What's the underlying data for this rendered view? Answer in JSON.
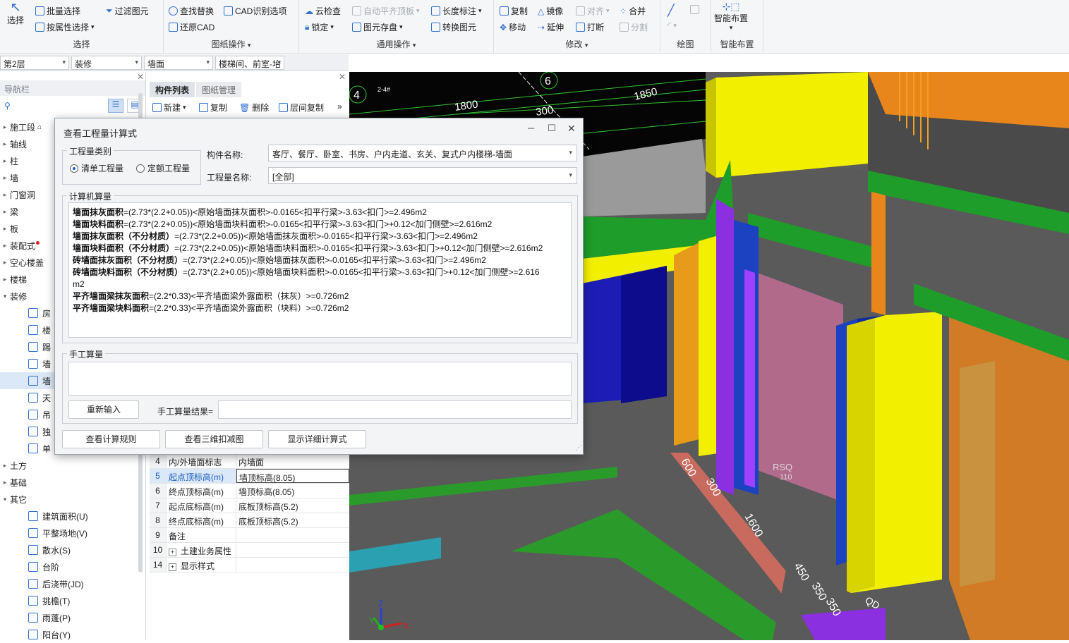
{
  "ribbon": {
    "groups": [
      {
        "title": "选择",
        "items": [
          "选择",
          "批量选择",
          "按属性选择",
          "过滤图元"
        ]
      },
      {
        "title": "图纸操作",
        "items": [
          "查找替换",
          "CAD识别选项",
          "还原CAD"
        ]
      },
      {
        "title": "通用操作",
        "items": [
          "云检查",
          "自动平齐顶板",
          "长度标注",
          "锁定",
          "图元存盘",
          "转换图元"
        ]
      },
      {
        "title": "修改",
        "items": [
          "复制",
          "镜像",
          "对齐",
          "合并",
          "移动",
          "延伸",
          "打断",
          "分割"
        ]
      },
      {
        "title": "绘图",
        "items": []
      },
      {
        "title": "智能布置",
        "items": [
          "智能布置"
        ]
      }
    ]
  },
  "selectors": [
    "第2层",
    "装修",
    "墙面",
    "楼梯间、前室-坮"
  ],
  "nav": {
    "title": "导航栏",
    "items": [
      "施工段",
      "轴线",
      "柱",
      "墙",
      "门窗洞",
      "梁",
      "板",
      "装配式",
      "空心楼盖",
      "楼梯",
      "装修",
      "房",
      "楼",
      "踢",
      "墙",
      "墙",
      "天",
      "吊",
      "独",
      "单",
      "土方",
      "基础",
      "其它",
      "建筑面积(U)",
      "平整场地(V)",
      "散水(S)",
      "台阶",
      "后浇带(JD)",
      "挑檐(T)",
      "雨蓬(P)",
      "阳台(Y)"
    ]
  },
  "comp": {
    "tabs": [
      "构件列表",
      "图纸管理"
    ],
    "toolbar": [
      "新建",
      "复制",
      "删除",
      "层间复制"
    ],
    "props": [
      {
        "n": "4",
        "k": "内/外墙面标志",
        "v": "内墙面"
      },
      {
        "n": "5",
        "k": "起点顶标高(m)",
        "v": "墙顶标高(8.05)"
      },
      {
        "n": "6",
        "k": "终点顶标高(m)",
        "v": "墙顶标高(8.05)"
      },
      {
        "n": "7",
        "k": "起点底标高(m)",
        "v": "底板顶标高(5.2)"
      },
      {
        "n": "8",
        "k": "终点底标高(m)",
        "v": "底板顶标高(5.2)"
      },
      {
        "n": "9",
        "k": "备注",
        "v": ""
      },
      {
        "n": "10",
        "k": "土建业务属性",
        "v": ""
      },
      {
        "n": "14",
        "k": "显示样式",
        "v": ""
      }
    ]
  },
  "view": {
    "labels": [
      "4",
      "6",
      "2-4#",
      "1800",
      "300",
      "1850",
      "600",
      "300",
      "1600",
      "450",
      "350",
      "350",
      "RSQ",
      "110",
      "QD",
      "X",
      "Y",
      "Z"
    ]
  },
  "dialog": {
    "title": "查看工程量计算式",
    "category_legend": "工程量类别",
    "radio1": "清单工程量",
    "radio2": "定额工程量",
    "comp_name_label": "构件名称:",
    "comp_name_value": "客厅、餐厅、卧室、书房、户内走道、玄关、复式户内楼梯-墙面",
    "qty_name_label": "工程量名称:",
    "qty_name_value": "[全部]",
    "computer_legend": "计算机算量",
    "formulas": [
      {
        "b": "墙面抹灰面积",
        "t": "=(2.73*(2.2+0.05))<原始墙面抹灰面积>-0.0165<扣平行梁>-3.63<扣门>=2.496m2"
      },
      {
        "b": "墙面块料面积",
        "t": "=(2.73*(2.2+0.05))<原始墙面块料面积>-0.0165<扣平行梁>-3.63<扣门>+0.12<加门侧壁>=2.616m2"
      },
      {
        "b": "墙面抹灰面积（不分材质）",
        "t": "=(2.73*(2.2+0.05))<原始墙面抹灰面积>-0.0165<扣平行梁>-3.63<扣门>=2.496m2"
      },
      {
        "b": "墙面块料面积（不分材质）",
        "t": "=(2.73*(2.2+0.05))<原始墙面块料面积>-0.0165<扣平行梁>-3.63<扣门>+0.12<加门侧壁>=2.616m2"
      },
      {
        "b": "砖墙面抹灰面积（不分材质）",
        "t": "=(2.73*(2.2+0.05))<原始墙面抹灰面积>-0.0165<扣平行梁>-3.63<扣门>=2.496m2"
      },
      {
        "b": "砖墙面块料面积（不分材质）",
        "t": "=(2.73*(2.2+0.05))<原始墙面块料面积>-0.0165<扣平行梁>-3.63<扣门>+0.12<加门侧壁>=2.616"
      },
      {
        "b": "",
        "t": "m2"
      },
      {
        "b": "平齐墙面梁抹灰面积",
        "t": "=(2.2*0.33)<平齐墙面梁外露面积（抹灰）>=0.726m2"
      },
      {
        "b": "平齐墙面梁块料面积",
        "t": "=(2.2*0.33)<平齐墙面梁外露面积（块料）>=0.726m2"
      }
    ],
    "manual_legend": "手工算量",
    "reinput": "重新输入",
    "manual_result_label": "手工算量结果=",
    "buttons": [
      "查看计算规则",
      "查看三维扣减图",
      "显示详细计算式"
    ]
  }
}
